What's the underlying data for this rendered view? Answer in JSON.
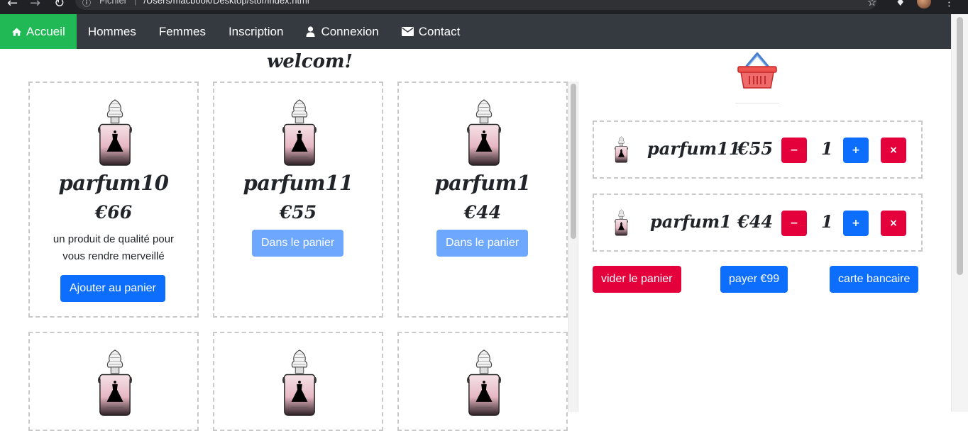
{
  "browser": {
    "info_label": "Fichier",
    "url": "/Users/macbook/Desktop/stor/index.html"
  },
  "navbar": {
    "items": [
      {
        "label": "Accueil",
        "icon": "home-icon"
      },
      {
        "label": "Hommes"
      },
      {
        "label": "Femmes"
      },
      {
        "label": "Inscription"
      },
      {
        "label": "Connexion",
        "icon": "user-icon"
      },
      {
        "label": "Contact",
        "icon": "envelope-icon"
      }
    ],
    "colors": {
      "bar": "#343a40",
      "active": "#20b956"
    }
  },
  "main": {
    "welcome": "welcom!",
    "products": [
      {
        "name": "parfum10",
        "price": "€66",
        "description": "un produit de qualité pour vous rendre merveillé",
        "button": "Ajouter au panier",
        "in_cart": false
      },
      {
        "name": "parfum11",
        "price": "€55",
        "button": "Dans le panier",
        "in_cart": true
      },
      {
        "name": "parfum1",
        "price": "€44",
        "button": "Dans le panier",
        "in_cart": true
      }
    ]
  },
  "cart": {
    "icon": "basket-icon",
    "items": [
      {
        "name": "parfum11",
        "price": "€55",
        "quantity": "1",
        "decrease": "−",
        "increase": "+",
        "remove": "×"
      },
      {
        "name": "parfum1",
        "price": "€44",
        "quantity": "1",
        "decrease": "−",
        "increase": "+",
        "remove": "×"
      }
    ],
    "empty_button": "vider le panier",
    "pay_button": "payer €99",
    "card_button": "carte bancaire"
  },
  "colors": {
    "primary": "#0d6efd",
    "primary_disabled": "#6ea8fe",
    "danger": "#e4003b"
  }
}
